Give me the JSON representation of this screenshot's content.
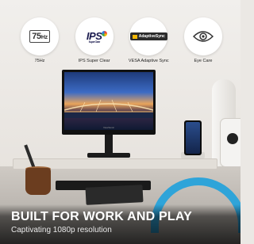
{
  "features": [
    {
      "icon": "75hz-icon",
      "badge_main": "75",
      "badge_unit": "Hz",
      "label": "75Hz"
    },
    {
      "icon": "ips-icon",
      "badge_main": "IPS",
      "badge_sub": "Super Clear",
      "label": "IPS Super Clear"
    },
    {
      "icon": "adaptive-sync-icon",
      "badge_main": "AdaptiveSync",
      "label": "VESA Adaptive Sync"
    },
    {
      "icon": "eye-icon",
      "label": "Eye Care"
    }
  ],
  "monitor": {
    "brand": "ViewSonic"
  },
  "caption": {
    "headline": "BUILT FOR WORK AND PLAY",
    "subline": "Captivating 1080p resolution"
  },
  "colors": {
    "headphone_accent": "#2fa4d9",
    "caption_text": "#ffffff"
  }
}
